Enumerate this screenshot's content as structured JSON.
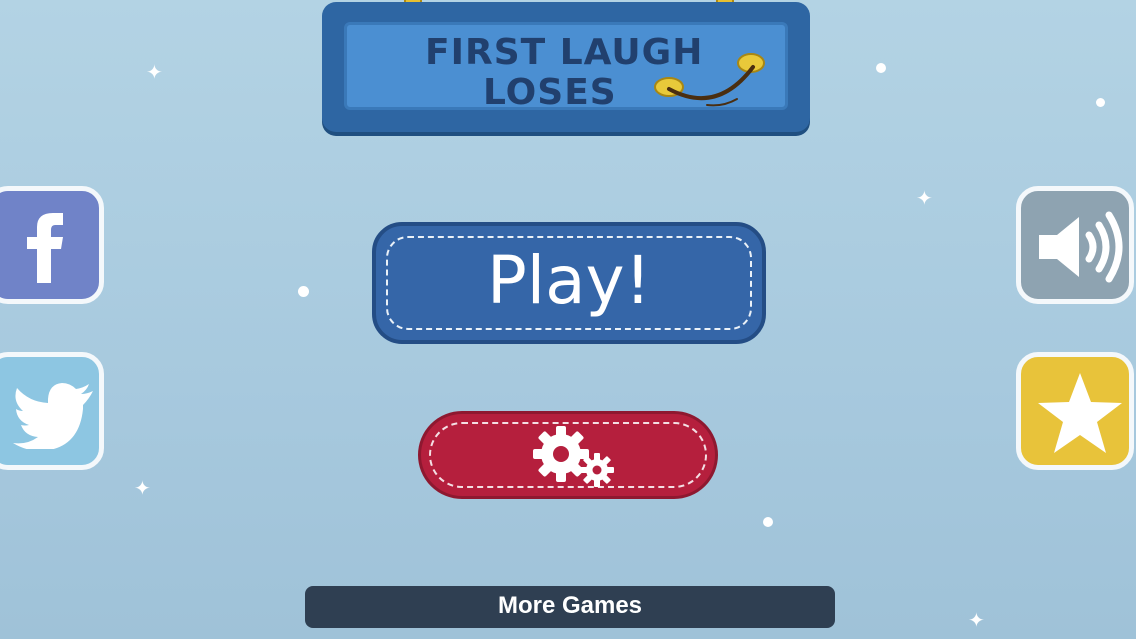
{
  "title": {
    "line1": "FIRST LAUGH",
    "line2": "LOSES"
  },
  "play_button": {
    "label": "Play!"
  },
  "settings_button": {
    "icon": "gears-icon"
  },
  "more_games_button": {
    "label": "More Games"
  },
  "side_buttons": {
    "facebook": {
      "icon": "facebook-icon"
    },
    "twitter": {
      "icon": "twitter-icon"
    },
    "sound": {
      "icon": "speaker-icon"
    },
    "rate": {
      "icon": "star-icon"
    }
  },
  "colors": {
    "background": "#aecde1",
    "title_sign": "#4b8fd2",
    "play": "#3566a8",
    "settings": "#b51f3d",
    "more_games": "#2f3f52",
    "facebook": "#7083c8",
    "twitter": "#8dc6e2",
    "sound": "#8ea3b1",
    "star": "#e8c33a"
  }
}
